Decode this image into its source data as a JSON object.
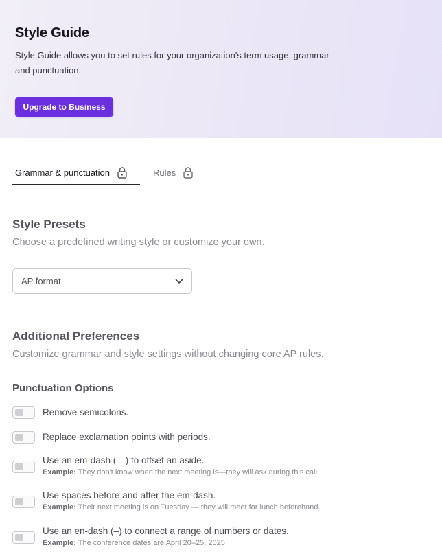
{
  "hero": {
    "title": "Style Guide",
    "description": "Style Guide allows you to set rules for your organization's term usage, grammar and punctuation.",
    "upgrade_label": "Upgrade to Business",
    "accent_color": "#6b2fe0"
  },
  "tabs": [
    {
      "label": "Grammar & punctuation",
      "icon": "lock-icon",
      "active": true
    },
    {
      "label": "Rules",
      "icon": "lock-icon",
      "active": false
    }
  ],
  "style_presets": {
    "title": "Style Presets",
    "subtitle": "Choose a predefined writing style or customize your own.",
    "selected": "AP format"
  },
  "additional": {
    "title": "Additional Preferences",
    "subtitle": "Customize grammar and style settings without changing core AP rules."
  },
  "punctuation": {
    "title": "Punctuation Options",
    "example_prefix": "Example:",
    "options": [
      {
        "label": "Remove semicolons.",
        "enabled": false
      },
      {
        "label": "Replace exclamation points with periods.",
        "enabled": false
      },
      {
        "label": "Use an em-dash (—) to offset an aside.",
        "example": "They don't know when the next meeting is—they will ask during this call.",
        "enabled": false
      },
      {
        "label": "Use spaces before and after the em-dash.",
        "example": "Their next meeting is on Tuesday — they will meet for lunch beforehand.",
        "enabled": false
      },
      {
        "label": "Use an en-dash (–) to connect a range of numbers or dates.",
        "example": "The conference dates are April 20–25, 2025.",
        "enabled": false
      }
    ]
  }
}
